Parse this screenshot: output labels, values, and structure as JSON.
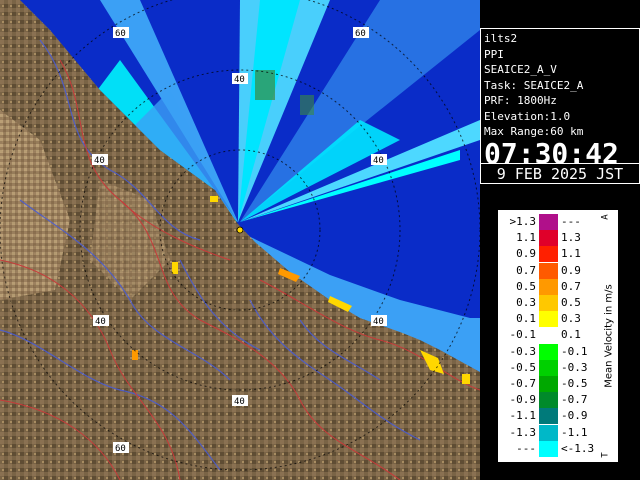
{
  "radar_view": {
    "range_rings": [
      {
        "label": "40",
        "positions": [
          "ne",
          "nw",
          "sw",
          "se",
          "s"
        ]
      },
      {
        "label": "60",
        "positions": [
          "nw",
          "ne",
          "sw"
        ]
      }
    ],
    "land_color": "#7a6446",
    "sea_color": "#0a2cc8",
    "echo_colors": {
      "light_blue": "#3ba0f5",
      "cyan": "#00ffff",
      "aqua": "#4dd8ff",
      "green": "#3a8a40",
      "yellow": "#ffd700",
      "orange": "#ff9900"
    }
  },
  "info": {
    "station": "ilts2",
    "product": "PPI",
    "task_name": "SEAICE2_A_V",
    "task": "Task: SEAICE2_A",
    "prf": "PRF: 1800Hz",
    "elevation": "Elevation:1.0",
    "max_range": "Max Range:60 km",
    "time": "07:30:42",
    "date": "9 FEB 2025 JST"
  },
  "legend": {
    "title": "Mean Velocity in m/s",
    "top_marker": "A",
    "bottom_marker": "T",
    "rows": [
      {
        "left": ">1.3",
        "right": "---",
        "color": "#b0108a"
      },
      {
        "left": "1.1",
        "right": "1.3",
        "color": "#e0002a"
      },
      {
        "left": "0.9",
        "right": "1.1",
        "color": "#ff2000"
      },
      {
        "left": "0.7",
        "right": "0.9",
        "color": "#ff5a00"
      },
      {
        "left": "0.5",
        "right": "0.7",
        "color": "#ff9900"
      },
      {
        "left": "0.3",
        "right": "0.5",
        "color": "#ffc800"
      },
      {
        "left": "0.1",
        "right": "0.3",
        "color": "#ffff00"
      },
      {
        "left": "-0.1",
        "right": "0.1",
        "color": "#ffffff"
      },
      {
        "left": "-0.3",
        "right": "-0.1",
        "color": "#00ff00"
      },
      {
        "left": "-0.5",
        "right": "-0.3",
        "color": "#00d000"
      },
      {
        "left": "-0.7",
        "right": "-0.5",
        "color": "#00a800"
      },
      {
        "left": "-0.9",
        "right": "-0.7",
        "color": "#008a2a"
      },
      {
        "left": "-1.1",
        "right": "-0.9",
        "color": "#007a7a"
      },
      {
        "left": "-1.3",
        "right": "-1.1",
        "color": "#00b8c8"
      },
      {
        "left": "---",
        "right": "<-1.3",
        "color": "#00ffff"
      }
    ]
  }
}
